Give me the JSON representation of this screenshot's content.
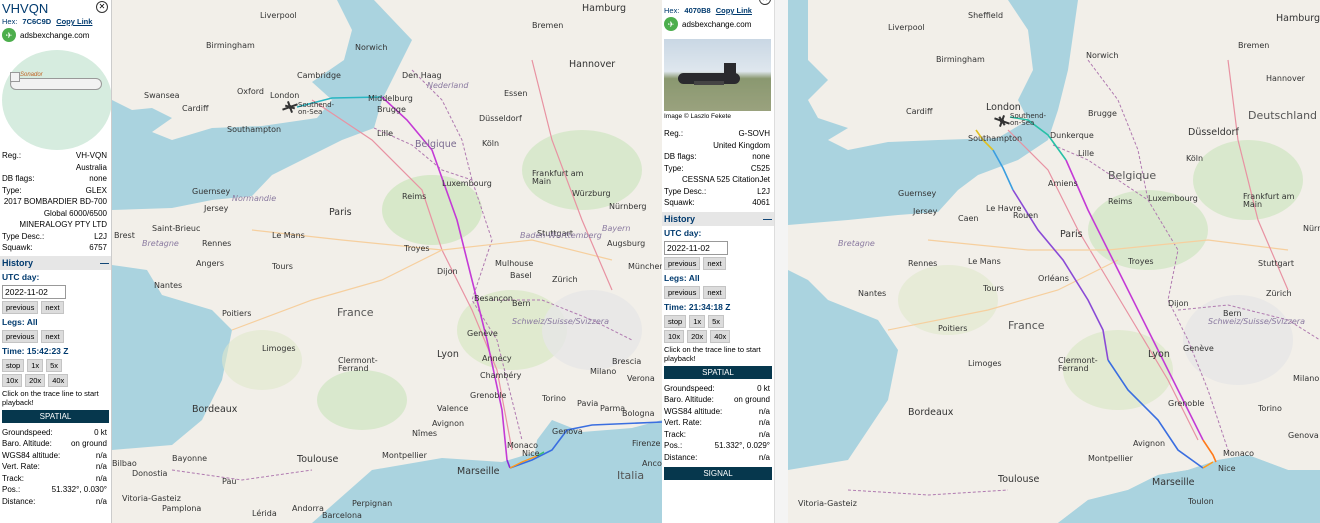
{
  "left_panel": {
    "callsign": "VHVQN",
    "hex_label": "Hex:",
    "hex": "7C6C9D",
    "copy_link": "Copy Link",
    "source": "adsbexchange.com",
    "logo_text": "Sonador",
    "details": [
      {
        "k": "Reg.:",
        "v": "VH-VQN"
      },
      {
        "k": "",
        "v": "Australia"
      },
      {
        "k": "DB flags:",
        "v": "none"
      },
      {
        "k": "Type:",
        "v": "GLEX"
      },
      {
        "k": "2017 BOMBARDIER BD-700",
        "v": ""
      },
      {
        "k": "",
        "v": "Global 6000/6500"
      },
      {
        "k": "",
        "v": "MINERALOGY PTY LTD"
      },
      {
        "k": "Type Desc.:",
        "v": "L2J"
      },
      {
        "k": "Squawk:",
        "v": "6757"
      }
    ],
    "history_label": "History",
    "utc_day_label": "UTC day:",
    "utc_day": "2022-11-02",
    "previous": "previous",
    "next": "next",
    "legs_label": "Legs: All",
    "time_label": "Time: 15:42:23 Z",
    "speeds": [
      "stop",
      "1x",
      "5x"
    ],
    "speeds2": [
      "10x",
      "20x",
      "40x"
    ],
    "note": "Click on the trace line to start playback!",
    "spatial": "SPATIAL",
    "spatial_rows": [
      {
        "k": "Groundspeed:",
        "v": "0 kt"
      },
      {
        "k": "Baro. Altitude:",
        "v": "on ground"
      },
      {
        "k": "WGS84 altitude:",
        "v": "n/a"
      },
      {
        "k": "Vert. Rate:",
        "v": "n/a"
      },
      {
        "k": "Track:",
        "v": "n/a"
      },
      {
        "k": "Pos.:",
        "v": "51.332°, 0.030°"
      },
      {
        "k": "Distance:",
        "v": "n/a"
      }
    ]
  },
  "mid_panel": {
    "hex_label": "Hex:",
    "hex": "4070B8",
    "copy_link": "Copy Link",
    "source": "adsbexchange.com",
    "image_credit": "Image © Laszlo Fekete",
    "details": [
      {
        "k": "Reg.:",
        "v": "G-SOVH"
      },
      {
        "k": "",
        "v": "United Kingdom"
      },
      {
        "k": "DB flags:",
        "v": "none"
      },
      {
        "k": "Type:",
        "v": "C525"
      },
      {
        "k": "",
        "v": "CESSNA 525 CitationJet"
      },
      {
        "k": "Type Desc.:",
        "v": "L2J"
      },
      {
        "k": "Squawk:",
        "v": "4061"
      }
    ],
    "history_label": "History",
    "utc_day_label": "UTC day:",
    "utc_day": "2022-11-02",
    "previous": "previous",
    "next": "next",
    "legs_label": "Legs: All",
    "time_label": "Time: 21:34:18 Z",
    "speeds": [
      "stop",
      "1x",
      "5x"
    ],
    "speeds2": [
      "10x",
      "20x",
      "40x"
    ],
    "note": "Click on the trace line to start playback!",
    "spatial": "SPATIAL",
    "spatial_rows": [
      {
        "k": "Groundspeed:",
        "v": "0 kt"
      },
      {
        "k": "Baro. Altitude:",
        "v": "on ground"
      },
      {
        "k": "WGS84 altitude:",
        "v": "n/a"
      },
      {
        "k": "Vert. Rate:",
        "v": "n/a"
      },
      {
        "k": "Track:",
        "v": "n/a"
      },
      {
        "k": "Pos.:",
        "v": "51.332°, 0.029°"
      },
      {
        "k": "Distance:",
        "v": "n/a"
      }
    ],
    "signal": "SIGNAL"
  },
  "map1_labels": [
    "Liverpool",
    "Birmingham",
    "Norwich",
    "Cambridge",
    "Oxford",
    "Cardiff",
    "Swansea",
    "London",
    "Southend-on-Sea",
    "Southampton",
    "Middelburg",
    "Brugge",
    "Lille",
    "Belgique",
    "Den Haag",
    "Bremen",
    "Hamburg",
    "Hannover",
    "Essen",
    "Düsseldorf",
    "Nederland",
    "Köln",
    "Frankfurt am Main",
    "Würzburg",
    "Nürnberg",
    "Luxembourg",
    "Stuttgart",
    "Baden-Württemberg",
    "Bayern",
    "Augsburg",
    "München",
    "Reims",
    "Paris",
    "Le Mans",
    "Tours",
    "Troyes",
    "Dijon",
    "Nantes",
    "Angers",
    "Poitiers",
    "Limoges",
    "Clermont-Ferrand",
    "Lyon",
    "Bordeaux",
    "Toulouse",
    "Montpellier",
    "Marseille",
    "Nice",
    "Monaco",
    "Genova",
    "Bologna",
    "Italia",
    "France",
    "Bretagne",
    "Normandie",
    "Guernsey",
    "Jersey",
    "Saint-Brieuc",
    "Brest",
    "Rennes",
    "Genève",
    "Annecy",
    "Chambéry",
    "Grenoble",
    "Valence",
    "Schweiz/Suisse/Svizzera",
    "Bern",
    "Zürich",
    "Basel",
    "Besançon",
    "Mulhouse",
    "Milano",
    "Torino",
    "Verona",
    "Brescia",
    "Parma",
    "Pavia",
    "Nîmes",
    "Avignon",
    "Firenze",
    "Ancona",
    "Bayonne",
    "Pau",
    "Andorra",
    "Perpignan",
    "Vitoria-Gasteiz",
    "Donostia",
    "Pamplona",
    "Bilbao",
    "Lérida",
    "Barcelona"
  ],
  "map2_labels": [
    "Liverpool",
    "Sheffield",
    "Birmingham",
    "Norwich",
    "Cardiff",
    "London",
    "Southend-on-Sea",
    "Southampton",
    "Bremen",
    "Hamburg",
    "Hannover",
    "Düsseldorf",
    "Köln",
    "Frankfurt am Main",
    "Luxembourg",
    "Nürnberg",
    "Stuttgart",
    "Dijon",
    "Paris",
    "Troyes",
    "Le Havre",
    "Reims",
    "Rennes",
    "Nantes",
    "Poitiers",
    "Limoges",
    "Clermont-Ferrand",
    "Lyon",
    "Grenoble",
    "Bordeaux",
    "Avignon",
    "Montpellier",
    "Marseille",
    "Toulon",
    "Nice",
    "Monaco",
    "Genova",
    "Torino",
    "Milano",
    "Schweiz/Suisse/Svizzera",
    "Zürich",
    "Bern",
    "Genève",
    "Vitoria-Gasteiz",
    "Toulouse",
    "France",
    "Deutschland",
    "Belgique",
    "Guernsey",
    "Jersey",
    "Bretagne",
    "Dunkerque",
    "Brugge",
    "Lille",
    "Amiens",
    "Orléans",
    "Tours",
    "Le Mans",
    "Caen",
    "Rouen"
  ],
  "colors": {
    "land": "#f2efe9",
    "water": "#aad3df",
    "forest": "#cfe6c1",
    "track_purple": "#c43ad6",
    "track_blue": "#3a6ee0",
    "panel_accent": "#003a6e",
    "bar": "#06374d"
  }
}
